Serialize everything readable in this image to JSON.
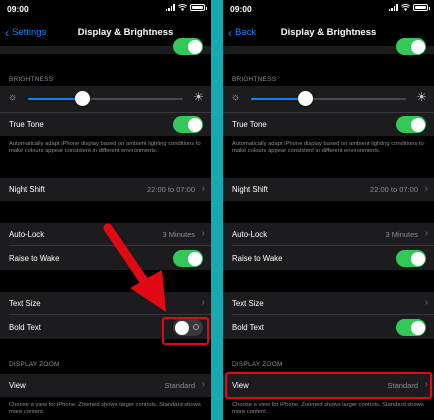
{
  "left": {
    "status": {
      "time": "09:00"
    },
    "nav": {
      "back": "Settings",
      "title": "Display & Brightness"
    },
    "brightness_label": "BRIGHTNESS",
    "brightness_level": 0.35,
    "true_tone": {
      "label": "True Tone",
      "on": true
    },
    "true_tone_note": "Automatically adapt iPhone display based on ambient lighting conditions to make colours appear consistent in different environments.",
    "night_shift": {
      "label": "Night Shift",
      "value": "22:00 to 07:00"
    },
    "auto_lock": {
      "label": "Auto-Lock",
      "value": "3 Minutes"
    },
    "raise_to_wake": {
      "label": "Raise to Wake",
      "on": true
    },
    "text_size": {
      "label": "Text Size"
    },
    "bold_text": {
      "label": "Bold Text",
      "on": false
    },
    "display_zoom_label": "DISPLAY ZOOM",
    "view": {
      "label": "View",
      "value": "Standard"
    },
    "view_note": "Choose a view for iPhone. Zoomed shows larger controls. Standard shows more content."
  },
  "right": {
    "status": {
      "time": "09:00"
    },
    "nav": {
      "back": "Back",
      "title": "Display & Brightness"
    },
    "brightness_label": "BRIGHTNESS",
    "brightness_level": 0.35,
    "true_tone": {
      "label": "True Tone",
      "on": true
    },
    "true_tone_note": "Automatically adapt iPhone display based on ambient lighting conditions to make colours appear consistent in different environments.",
    "night_shift": {
      "label": "Night Shift",
      "value": "22:00 to 07:00"
    },
    "auto_lock": {
      "label": "Auto-Lock",
      "value": "3 Minutes"
    },
    "raise_to_wake": {
      "label": "Raise to Wake",
      "on": true
    },
    "text_size": {
      "label": "Text Size"
    },
    "bold_text": {
      "label": "Bold Text",
      "on": true
    },
    "display_zoom_label": "DISPLAY ZOOM",
    "view": {
      "label": "View",
      "value": "Standard"
    },
    "view_note": "Choose a view for iPhone. Zoomed shows larger controls. Standard shows more content."
  },
  "colors": {
    "accent": "#0a84ff",
    "toggle_on": "#34c759",
    "highlight": "#e10a14",
    "divider": "#16a9b2"
  }
}
